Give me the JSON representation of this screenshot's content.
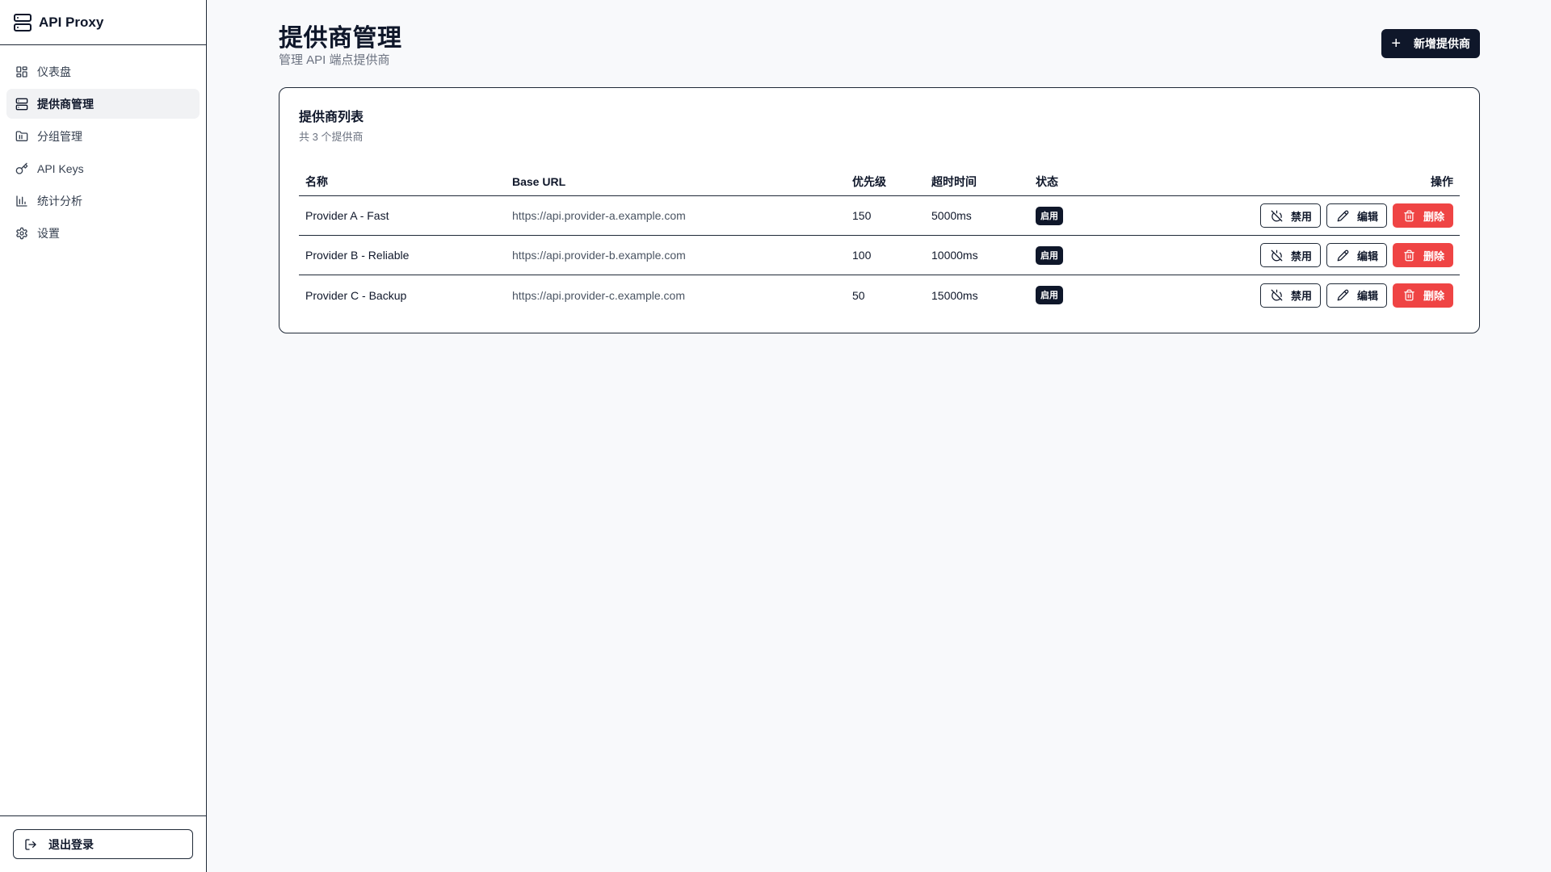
{
  "app": {
    "name": "API Proxy"
  },
  "sidebar": {
    "items": [
      {
        "label": "仪表盘",
        "icon": "dashboard-icon",
        "active": false
      },
      {
        "label": "提供商管理",
        "icon": "server-icon",
        "active": true
      },
      {
        "label": "分组管理",
        "icon": "folder-icon",
        "active": false
      },
      {
        "label": "API Keys",
        "icon": "key-icon",
        "active": false
      },
      {
        "label": "统计分析",
        "icon": "bar-chart-icon",
        "active": false
      },
      {
        "label": "设置",
        "icon": "gear-icon",
        "active": false
      }
    ],
    "logout_label": "退出登录"
  },
  "page": {
    "title": "提供商管理",
    "subtitle": "管理 API 端点提供商",
    "add_button": "新增提供商"
  },
  "card": {
    "title": "提供商列表",
    "subtitle": "共 3 个提供商"
  },
  "table": {
    "headers": {
      "name": "名称",
      "url": "Base URL",
      "priority": "优先级",
      "timeout": "超时时间",
      "status": "状态",
      "actions": "操作"
    },
    "rows": [
      {
        "name": "Provider A - Fast",
        "url": "https://api.provider-a.example.com",
        "priority": "150",
        "timeout": "5000ms",
        "status": "启用"
      },
      {
        "name": "Provider B - Reliable",
        "url": "https://api.provider-b.example.com",
        "priority": "100",
        "timeout": "10000ms",
        "status": "启用"
      },
      {
        "name": "Provider C - Backup",
        "url": "https://api.provider-c.example.com",
        "priority": "50",
        "timeout": "15000ms",
        "status": "启用"
      }
    ],
    "actions": {
      "disable": "禁用",
      "edit": "编辑",
      "delete": "删除"
    }
  },
  "colors": {
    "primary": "#0f172a",
    "danger": "#ef4444",
    "background": "#f8f9fb"
  }
}
